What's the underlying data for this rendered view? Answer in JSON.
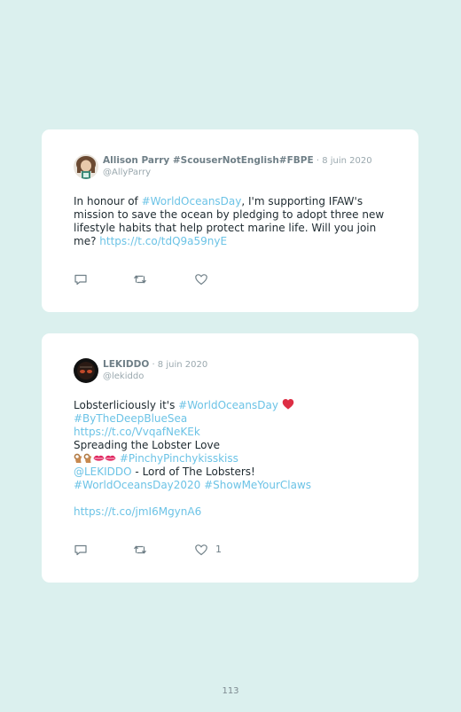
{
  "tweets": [
    {
      "author_name": "Allison Parry #ScouserNotEnglish#FBPE",
      "date": " · 8 juin 2020",
      "handle": "@AllyParry",
      "text": {
        "l1_a": "In honour of ",
        "l1_link": "#WorldOceansDay",
        "l1_b": ", I'm supporting IFAW's",
        "l2": "mission to save the ocean by pledging to adopt three new",
        "l3": "lifestyle habits that help protect marine life. Will you join",
        "l4_a": "me? ",
        "l4_link": "https://t.co/tdQ9a59nyE"
      },
      "likes": ""
    },
    {
      "author_name": "LEKIDDO",
      "date": " · 8 juin 2020",
      "handle": "@lekiddo",
      "text": {
        "l1_a": "Lobsterliciously it's ",
        "l1_link": "#WorldOceansDay",
        "l2": "#ByTheDeepBlueSea",
        "l3": "https://t.co/VvqafNeKEk",
        "l4": "Spreading the Lobster Love",
        "l5_link": "#PinchyPinchykisskiss",
        "l6_link": "@LEKIDDO",
        "l6_b": " - Lord of The Lobsters!",
        "l7": "#WorldOceansDay2020 #ShowMeYourClaws",
        "l9": "https://t.co/jmI6MgynA6"
      },
      "likes": "1"
    }
  ],
  "colors": {
    "background": "#dbf0ee",
    "link": "#6cc3e6",
    "heart_emoji": "#dd2e44"
  },
  "icons": [
    "reply-icon",
    "retweet-icon",
    "like-icon",
    "heart-emoji-icon",
    "ok-hand-emoji-icon",
    "kiss-mark-emoji-icon"
  ],
  "page_number": "113"
}
